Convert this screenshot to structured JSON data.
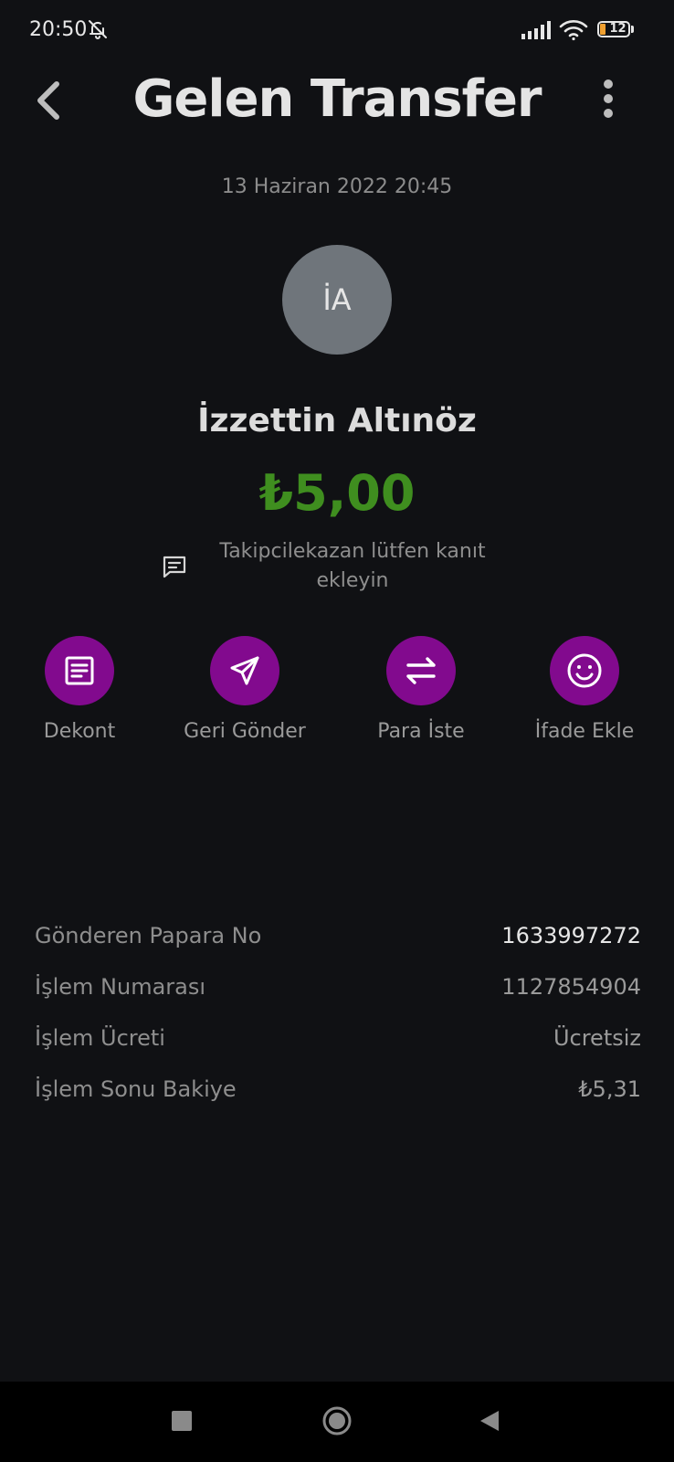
{
  "status_bar": {
    "time": "20:50",
    "battery_level": "12",
    "icons": [
      "bell-off-icon",
      "signal-icon",
      "wifi-icon",
      "battery-icon"
    ]
  },
  "header": {
    "title": "Gelen Transfer",
    "back_icon": "chevron-left-icon",
    "menu_icon": "more-vertical-icon"
  },
  "transaction": {
    "date": "13 Haziran 2022 20:45",
    "avatar_initials": "İA",
    "sender_name": "İzzettin Altınöz",
    "amount": "₺5,00",
    "note": "Takipcilekazan lütfen kanıt ekleyin",
    "note_icon": "message-icon"
  },
  "actions": [
    {
      "label": "Dekont",
      "icon": "receipt-icon"
    },
    {
      "label": "Geri Gönder",
      "icon": "send-icon"
    },
    {
      "label": "Para İste",
      "icon": "swap-icon"
    },
    {
      "label": "İfade Ekle",
      "icon": "emoji-icon"
    }
  ],
  "details": [
    {
      "label": "Gönderen Papara No",
      "value": "1633997272"
    },
    {
      "label": "İşlem Numarası",
      "value": "1127854904"
    },
    {
      "label": "İşlem Ücreti",
      "value": "Ücretsiz"
    },
    {
      "label": "İşlem Sonu Bakiye",
      "value": "₺5,31"
    }
  ],
  "colors": {
    "background": "#101114",
    "accent_purple": "#820a8e",
    "amount_green": "#3f8e1f",
    "avatar_gray": "#6f757b"
  },
  "nav_bar": {
    "icons": [
      "recents-square-icon",
      "home-circle-icon",
      "back-triangle-icon"
    ]
  }
}
